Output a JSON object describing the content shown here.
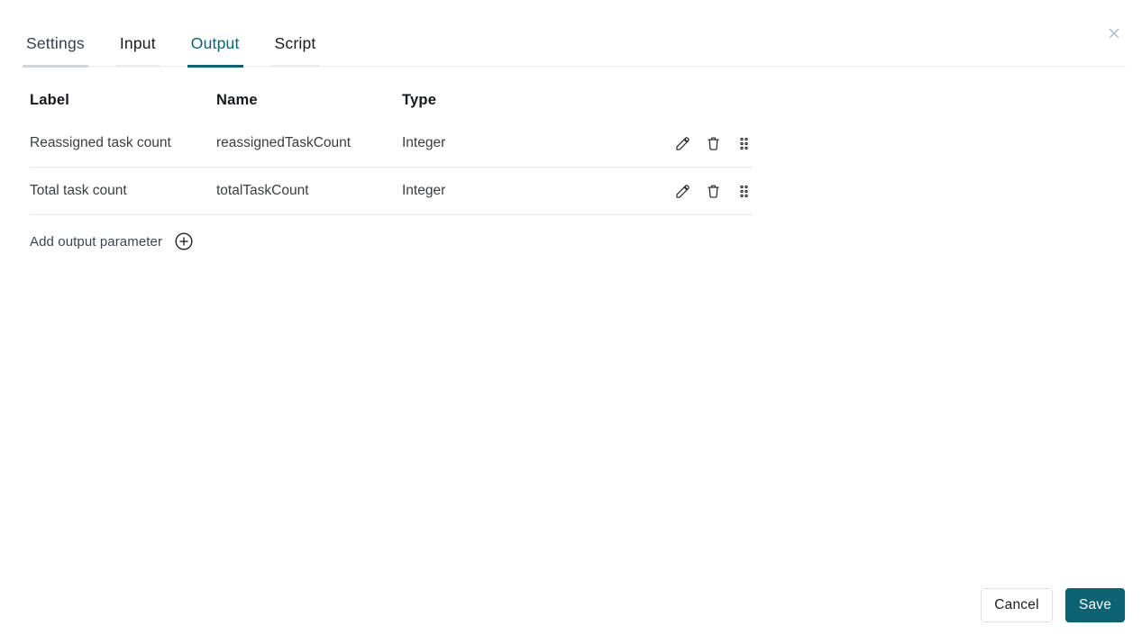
{
  "dialog": {
    "tabs": [
      {
        "label": "Settings",
        "active": false
      },
      {
        "label": "Input",
        "active": false
      },
      {
        "label": "Output",
        "active": true
      },
      {
        "label": "Script",
        "active": false
      }
    ],
    "table": {
      "headers": {
        "label": "Label",
        "name": "Name",
        "type": "Type"
      },
      "rows": [
        {
          "label": "Reassigned task count",
          "name": "reassignedTaskCount",
          "type": "Integer"
        },
        {
          "label": "Total task count",
          "name": "totalTaskCount",
          "type": "Integer"
        }
      ],
      "row_action_icons": [
        "pencil-icon",
        "trash-icon",
        "drag-indicator-icon"
      ]
    },
    "add_parameter": {
      "label": "Add output parameter",
      "icon": "plus-circle-icon"
    },
    "footer": {
      "cancel_label": "Cancel",
      "save_label": "Save"
    },
    "icons": {
      "close": "close-x-icon"
    },
    "colors": {
      "accent_teal": "#0d6271",
      "active_tab": "#0d6372",
      "settings_tab_text": "#333f52",
      "settings_tab_underline": "#d2d5db",
      "inactive_tab_underline": "#ededed",
      "divider": "#e6e6e6",
      "close_icon": "#a9b8c6",
      "icon_stroke": "#202224"
    }
  }
}
